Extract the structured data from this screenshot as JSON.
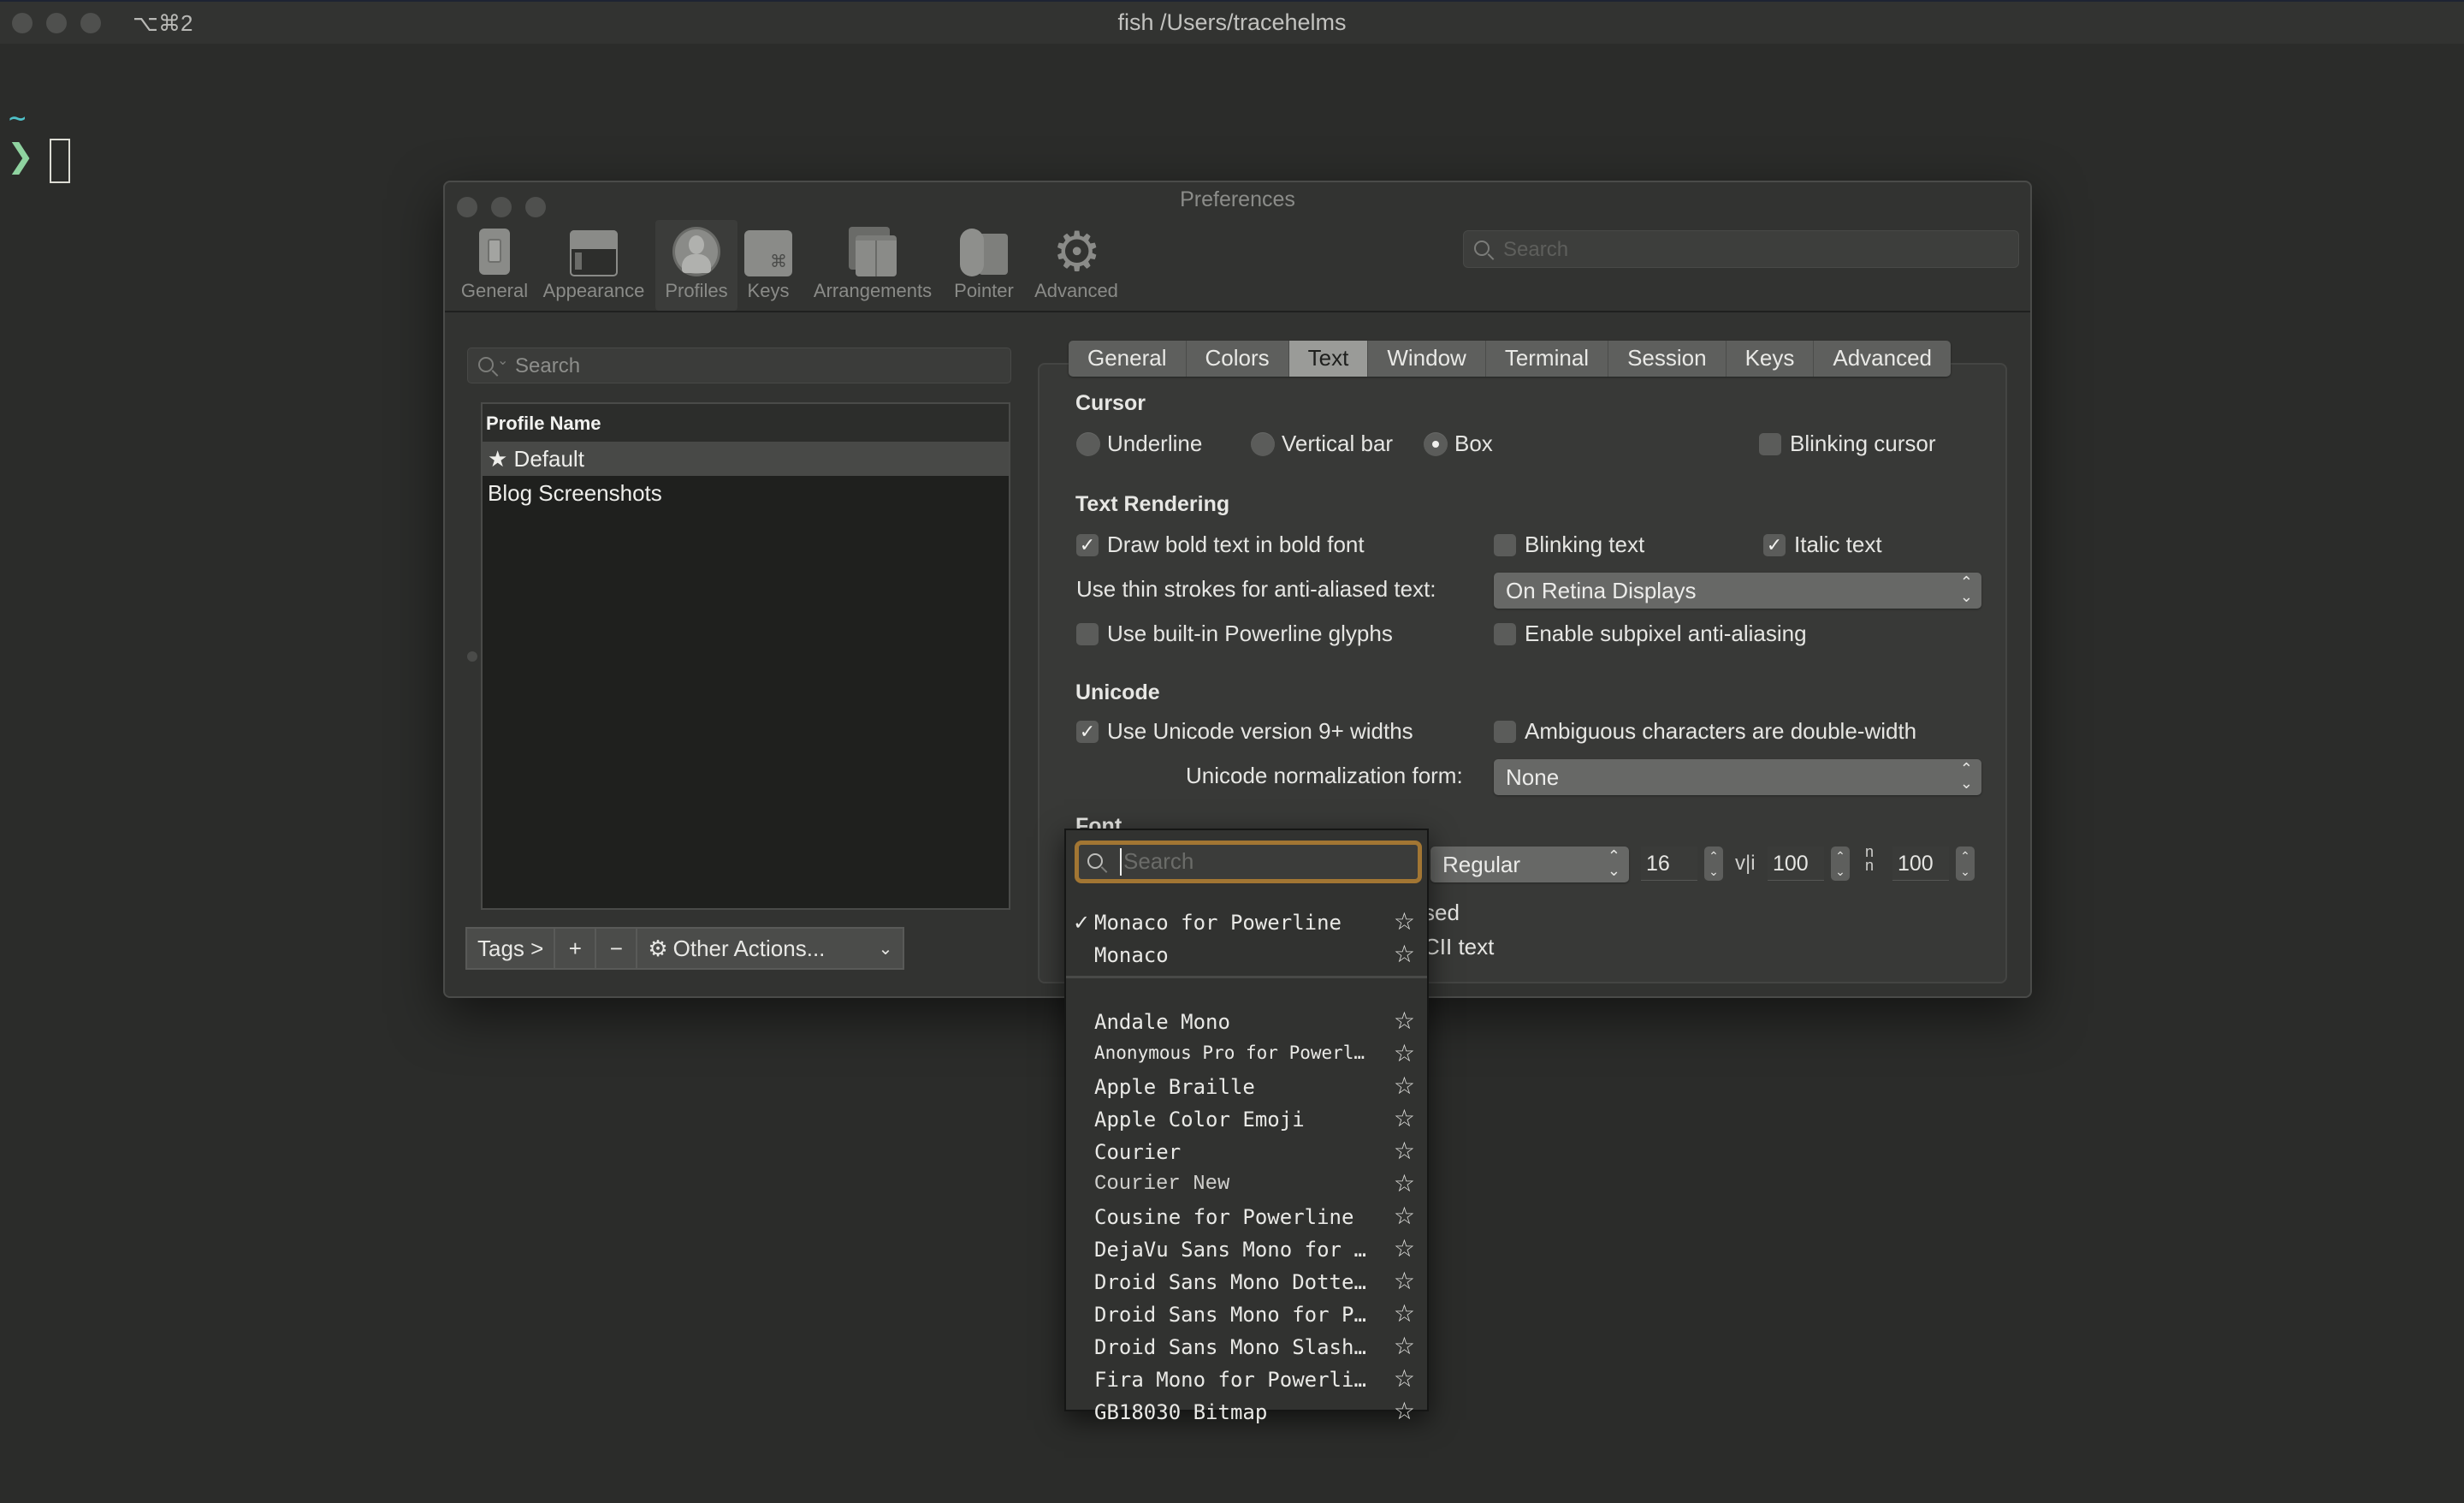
{
  "terminal": {
    "tab_shortcut": "⌥⌘2",
    "title": "fish /Users/tracehelms",
    "prompt_dir": "~",
    "prompt_symbol": "❯"
  },
  "preferences": {
    "title": "Preferences",
    "toolbar": [
      {
        "label": "General",
        "icon": "general-switch-icon"
      },
      {
        "label": "Appearance",
        "icon": "appearance-window-icon"
      },
      {
        "label": "Profiles",
        "icon": "profile-person-icon",
        "active": true
      },
      {
        "label": "Keys",
        "icon": "keys-command-icon"
      },
      {
        "label": "Arrangements",
        "icon": "arrangements-windows-icon"
      },
      {
        "label": "Pointer",
        "icon": "pointer-mouse-icon"
      },
      {
        "label": "Advanced",
        "icon": "advanced-gear-icon"
      }
    ],
    "search_placeholder": "Search",
    "profiles": {
      "search_placeholder": "Search",
      "column_header": "Profile Name",
      "rows": [
        {
          "name": "Default",
          "default": true,
          "selected": true
        },
        {
          "name": "Blog Screenshots",
          "default": false,
          "selected": false
        }
      ],
      "buttons": {
        "tags": "Tags >",
        "add": "+",
        "remove": "−",
        "other_actions": "Other Actions..."
      }
    },
    "tabs": [
      "General",
      "Colors",
      "Text",
      "Window",
      "Terminal",
      "Session",
      "Keys",
      "Advanced"
    ],
    "active_tab": "Text",
    "text": {
      "cursor": {
        "heading": "Cursor",
        "options": [
          "Underline",
          "Vertical bar",
          "Box"
        ],
        "selected": "Box",
        "blinking_label": "Blinking cursor",
        "blinking": false
      },
      "rendering": {
        "heading": "Text Rendering",
        "draw_bold": {
          "label": "Draw bold text in bold font",
          "checked": true
        },
        "blinking_text": {
          "label": "Blinking text",
          "checked": false
        },
        "italic_text": {
          "label": "Italic text",
          "checked": true
        },
        "thin_strokes_label": "Use thin strokes for anti-aliased text:",
        "thin_strokes_value": "On Retina Displays",
        "powerline": {
          "label": "Use built-in Powerline glyphs",
          "checked": false
        },
        "subpixel": {
          "label": "Enable subpixel anti-aliasing",
          "checked": false
        }
      },
      "unicode": {
        "heading": "Unicode",
        "v9_widths": {
          "label": "Use Unicode version 9+ widths",
          "checked": true
        },
        "ambiguous": {
          "label": "Ambiguous characters are double-width",
          "checked": false
        },
        "normalization_label": "Unicode normalization form:",
        "normalization_value": "None"
      },
      "font": {
        "heading": "Font",
        "weight": "Regular",
        "size": "16",
        "h_spacing_icon": "v|i",
        "h_spacing": "100",
        "v_spacing_icon": "n/n",
        "v_spacing": "100",
        "hidden_option_1_fragment": "sed",
        "hidden_option_2_fragment": "CII text"
      }
    },
    "font_picker": {
      "search_placeholder": "Search",
      "recent": [
        {
          "name": "Monaco for Powerline",
          "checked": true
        },
        {
          "name": "Monaco",
          "checked": false
        }
      ],
      "fonts": [
        "Andale Mono",
        "Anonymous Pro for Powerl…",
        "Apple Braille",
        "Apple  Color  Emoji",
        "Courier",
        "Courier New",
        "Cousine for Powerline",
        "DejaVu Sans Mono for P…",
        "Droid Sans Mono Dotted…",
        "Droid Sans Mono for Po…",
        "Droid Sans Mono Slashe…",
        "Fira Mono for Powerline",
        "GB18030  Bitmap"
      ],
      "star_icon": "☆",
      "check_icon": "✓"
    }
  }
}
